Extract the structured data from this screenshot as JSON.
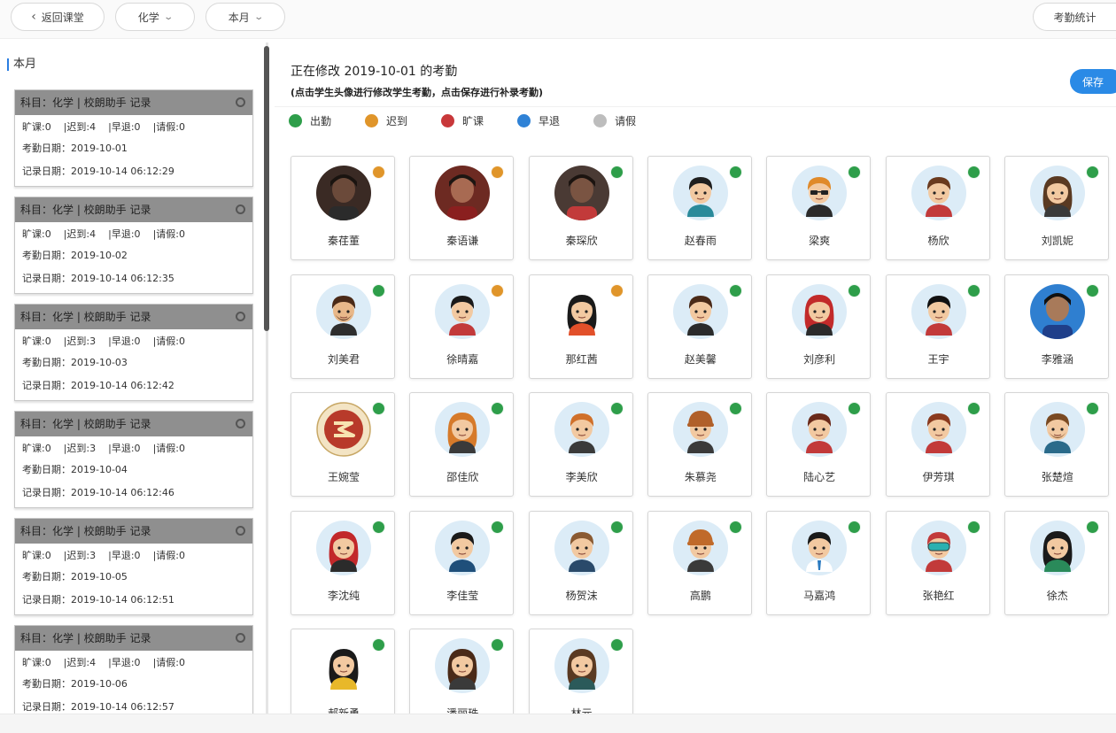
{
  "toolbar": {
    "back_label": "返回课堂",
    "subject_select": "化学",
    "period_select": "本月",
    "stats_button": "考勤统计"
  },
  "left": {
    "month_title": "本月",
    "records": [
      {
        "header": "科目：化学 | 校朗助手 记录",
        "stats": [
          "旷课:0",
          "|迟到:4",
          "|早退:0",
          "|请假:0"
        ],
        "attend_date": "考勤日期：2019-10-01",
        "record_date": "记录日期：2019-10-14 06:12:29"
      },
      {
        "header": "科目：化学 | 校朗助手 记录",
        "stats": [
          "旷课:0",
          "|迟到:4",
          "|早退:0",
          "|请假:0"
        ],
        "attend_date": "考勤日期：2019-10-02",
        "record_date": "记录日期：2019-10-14 06:12:35"
      },
      {
        "header": "科目：化学 | 校朗助手 记录",
        "stats": [
          "旷课:0",
          "|迟到:3",
          "|早退:0",
          "|请假:0"
        ],
        "attend_date": "考勤日期：2019-10-03",
        "record_date": "记录日期：2019-10-14 06:12:42"
      },
      {
        "header": "科目：化学 | 校朗助手 记录",
        "stats": [
          "旷课:0",
          "|迟到:3",
          "|早退:0",
          "|请假:0"
        ],
        "attend_date": "考勤日期：2019-10-04",
        "record_date": "记录日期：2019-10-14 06:12:46"
      },
      {
        "header": "科目：化学 | 校朗助手 记录",
        "stats": [
          "旷课:0",
          "|迟到:3",
          "|早退:0",
          "|请假:0"
        ],
        "attend_date": "考勤日期：2019-10-05",
        "record_date": "记录日期：2019-10-14 06:12:51"
      },
      {
        "header": "科目：化学 | 校朗助手 记录",
        "stats": [
          "旷课:0",
          "|迟到:4",
          "|早退:0",
          "|请假:0"
        ],
        "attend_date": "考勤日期：2019-10-06",
        "record_date": "记录日期：2019-10-14 06:12:57"
      }
    ]
  },
  "main": {
    "editing_title": "正在修改 2019-10-01 的考勤",
    "editing_hint": "(点击学生头像进行修改学生考勤，点击保存进行补录考勤)",
    "save_label": "保存",
    "legend": [
      {
        "label": "出勤",
        "color": "#2e9e4a"
      },
      {
        "label": "迟到",
        "color": "#e0952a"
      },
      {
        "label": "旷课",
        "color": "#c8383a"
      },
      {
        "label": "早退",
        "color": "#2f82d6"
      },
      {
        "label": "请假",
        "color": "#bdbdbd"
      }
    ],
    "status_colors": {
      "present": "#2e9e4a",
      "late": "#e0952a"
    },
    "students": [
      {
        "name": "秦荏董",
        "status": "late",
        "avatar": "photo-dark"
      },
      {
        "name": "秦语谦",
        "status": "late",
        "avatar": "photo-red"
      },
      {
        "name": "秦琛欣",
        "status": "present",
        "avatar": "photo-child"
      },
      {
        "name": "赵春雨",
        "status": "present",
        "avatar": "boy-teal"
      },
      {
        "name": "梁爽",
        "status": "present",
        "avatar": "boy-glasses"
      },
      {
        "name": "杨欣",
        "status": "present",
        "avatar": "boy-red"
      },
      {
        "name": "刘凯妮",
        "status": "present",
        "avatar": "girl-brown"
      },
      {
        "name": "刘美君",
        "status": "present",
        "avatar": "man-suit"
      },
      {
        "name": "徐晴嘉",
        "status": "late",
        "avatar": "boy-spiky"
      },
      {
        "name": "那红茜",
        "status": "late",
        "avatar": "girl-headband"
      },
      {
        "name": "赵美馨",
        "status": "present",
        "avatar": "boy-black"
      },
      {
        "name": "刘彦利",
        "status": "present",
        "avatar": "girl-red"
      },
      {
        "name": "王宇",
        "status": "present",
        "avatar": "girl-bob"
      },
      {
        "name": "李雅涵",
        "status": "present",
        "avatar": "photo-uniform"
      },
      {
        "name": "王婉莹",
        "status": "present",
        "avatar": "logo-badge"
      },
      {
        "name": "邵佳欣",
        "status": "present",
        "avatar": "girl-orange"
      },
      {
        "name": "李美欣",
        "status": "present",
        "avatar": "boy-orange"
      },
      {
        "name": "朱慕尧",
        "status": "present",
        "avatar": "girl-beanie"
      },
      {
        "name": "陆心艺",
        "status": "present",
        "avatar": "boy-red2"
      },
      {
        "name": "伊芳琪",
        "status": "present",
        "avatar": "boy-red3"
      },
      {
        "name": "张楚煊",
        "status": "present",
        "avatar": "boy-beard"
      },
      {
        "name": "李沈纯",
        "status": "present",
        "avatar": "girl-redhair"
      },
      {
        "name": "李佳莹",
        "status": "present",
        "avatar": "boy-navy"
      },
      {
        "name": "杨贺沫",
        "status": "present",
        "avatar": "boy-brown"
      },
      {
        "name": "高鹏",
        "status": "present",
        "avatar": "girl-hat"
      },
      {
        "name": "马嘉鸿",
        "status": "present",
        "avatar": "boy-tie"
      },
      {
        "name": "张艳红",
        "status": "present",
        "avatar": "goggles"
      },
      {
        "name": "徐杰",
        "status": "present",
        "avatar": "girl-green"
      },
      {
        "name": "郝新勇",
        "status": "present",
        "avatar": "girl-yellow"
      },
      {
        "name": "潘丽珠",
        "status": "present",
        "avatar": "girl-long"
      },
      {
        "name": "林元",
        "status": "present",
        "avatar": "girl-longbrown"
      }
    ]
  }
}
